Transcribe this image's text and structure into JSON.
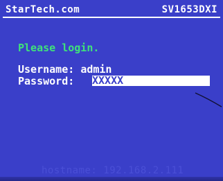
{
  "header": {
    "brand": "StarTech.com",
    "model": "SV1653DXI"
  },
  "login": {
    "prompt": "Please login.",
    "username_label": "Username:",
    "username_value": "admin",
    "password_label": "Password:",
    "password_value": "XXXXX"
  },
  "footer": {
    "hostname_line": "hostname: 192.168.2.111"
  },
  "colors": {
    "background": "#3a3fc9",
    "prompt_text": "#3fe27a",
    "text": "#ffffff",
    "field_bg": "#ffffff",
    "faint_text": "#4a4fd6"
  }
}
